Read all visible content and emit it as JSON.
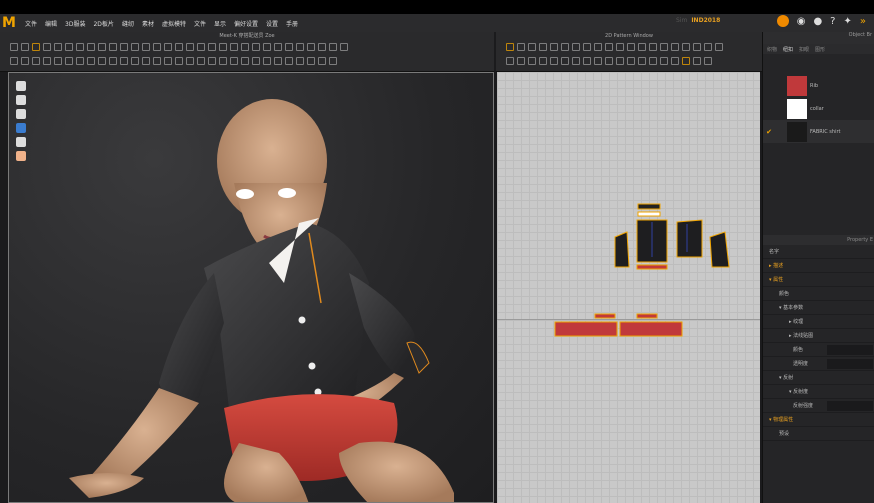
{
  "app": {
    "menu": [
      "文件",
      "编辑",
      "3D服装",
      "2D板片",
      "缝纫",
      "素材",
      "虚拟模特",
      "文件",
      "显示",
      "偏好设置",
      "设置",
      "手册"
    ],
    "product_label": "Sim",
    "product_code": "IND2018"
  },
  "toolbar3d": {
    "title": "Meet-K 穿搭配送员 Zoe"
  },
  "toolbar2d": {
    "title": "2D Pattern Window"
  },
  "right_panel": {
    "header": "Object Br",
    "tabs": [
      "织物",
      "纽扣",
      "扣眼",
      "图形"
    ],
    "fabrics": [
      {
        "name": "Rib",
        "color": "#c0393b",
        "selected": false
      },
      {
        "name": "collar",
        "color": "#ffffff",
        "selected": false
      },
      {
        "name": "FABRIC shirt",
        "color": "#1a1a1a",
        "selected": true
      }
    ],
    "property_header": "Property E",
    "properties": [
      {
        "label": "名字",
        "style": ""
      },
      {
        "label": "▸ 描述",
        "style": "o"
      },
      {
        "label": "▾ 属性",
        "style": "o"
      },
      {
        "label": "颜色",
        "style": "i1"
      },
      {
        "label": "▾ 基本参数",
        "style": "i1"
      },
      {
        "label": "▸ 纹理",
        "style": "i2"
      },
      {
        "label": "▸ 法线贴图",
        "style": "i2"
      },
      {
        "label": "颜色",
        "style": "i3"
      },
      {
        "label": "透明度",
        "style": "i3"
      },
      {
        "label": "▾ 反射",
        "style": "i1"
      },
      {
        "label": "▾ 反射度",
        "style": "i2"
      },
      {
        "label": "反射强度",
        "style": "i3"
      },
      {
        "label": "▾ 物理属性",
        "style": "o"
      },
      {
        "label": "预设",
        "style": "i1"
      }
    ]
  }
}
